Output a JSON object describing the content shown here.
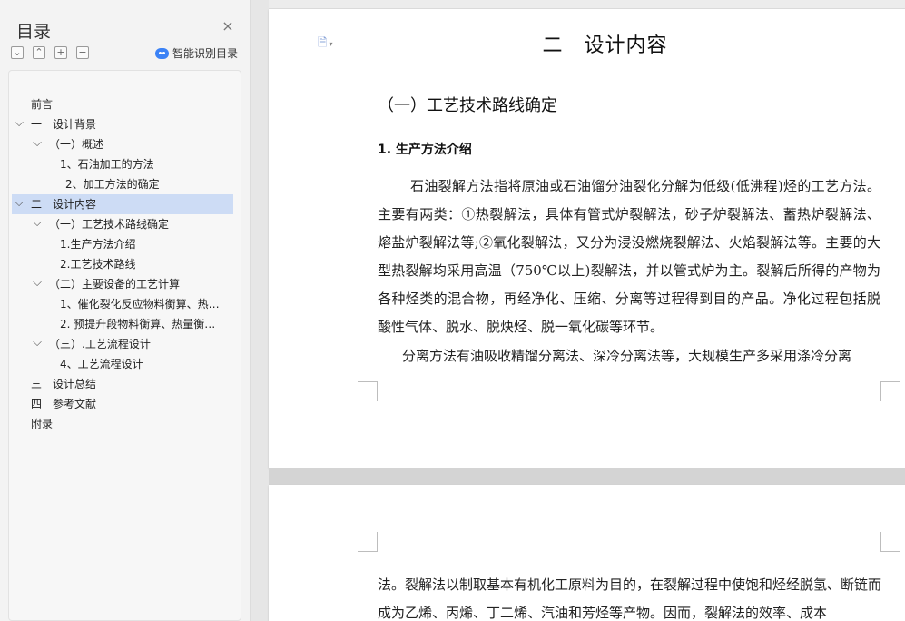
{
  "sidebar": {
    "title": "目录",
    "close": "×",
    "smart_toc_label": "智能识别目录",
    "tools": [
      "⌄",
      "⌃",
      "+",
      "−"
    ],
    "items": [
      {
        "label": "前言",
        "level": 0,
        "expand": false,
        "active": false
      },
      {
        "label": "一　设计背景",
        "level": 0,
        "expand": true,
        "active": false
      },
      {
        "label": "（一）概述",
        "level": 1,
        "expand": true,
        "active": false
      },
      {
        "label": "1、石油加工的方法",
        "level": 2,
        "expand": false,
        "active": false
      },
      {
        "label": "2、加工方法的确定",
        "level": 2,
        "expand": false,
        "active": false
      },
      {
        "label": "二　设计内容",
        "level": 0,
        "expand": true,
        "active": true
      },
      {
        "label": "（一）工艺技术路线确定",
        "level": 1,
        "expand": true,
        "active": false
      },
      {
        "label": "1.生产方法介绍",
        "level": 2,
        "expand": false,
        "active": false
      },
      {
        "label": "2.工艺技术路线",
        "level": 2,
        "expand": false,
        "active": false
      },
      {
        "label": "（二）主要设备的工艺计算",
        "level": 1,
        "expand": true,
        "active": false
      },
      {
        "label": "1、催化裂化反应物料衡算、热…",
        "level": 2,
        "expand": false,
        "active": false
      },
      {
        "label": "2. 预提升段物料衡算、热量衡…",
        "level": 2,
        "expand": false,
        "active": false
      },
      {
        "label": "（三）.工艺流程设计",
        "level": 1,
        "expand": true,
        "active": false
      },
      {
        "label": "4、工艺流程设计",
        "level": 2,
        "expand": false,
        "active": false
      },
      {
        "label": "三　设计总结",
        "level": 0,
        "expand": false,
        "active": false
      },
      {
        "label": "四　参考文献",
        "level": 0,
        "expand": false,
        "active": false
      },
      {
        "label": "附录",
        "level": 0,
        "expand": false,
        "active": false
      }
    ]
  },
  "doc": {
    "h1": "二　设计内容",
    "h2": "（一）工艺技术路线确定",
    "h3": "1. 生产方法介绍",
    "p1": "石油裂解方法指将原油或石油馏分油裂化分解为低级(低沸程)烃的工艺方法。主要有两类：①热裂解法，具体有管式炉裂解法，砂子炉裂解法、蓄热炉裂解法、熔盐炉裂解法等;②氧化裂解法，又分为浸没燃烧裂解法、火焰裂解法等。主要的大型热裂解均采用高温（750℃以上)裂解法，并以管式炉为主。裂解后所得的产物为各种烃类的混合物，再经净化、压缩、分离等过程得到目的产品。净化过程包括脱酸性气体、脱水、脱炔烃、脱一氧化碳等环节。",
    "p2": "分离方法有油吸收精馏分离法、深冷分离法等，大规模生产多采用涤冷分离",
    "p3": "法。裂解法以制取基本有机化工原料为目的，在裂解过程中使饱和烃经脱氢、断链而成为乙烯、丙烯、丁二烯、汽油和芳烃等产物。因而，裂解法的效率、成本"
  }
}
